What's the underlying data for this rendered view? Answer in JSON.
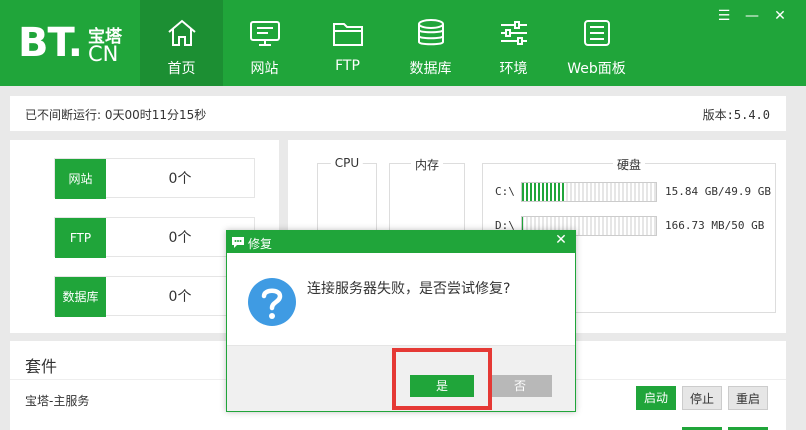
{
  "colors": {
    "brand": "#20a53a",
    "brand_dark": "#1c8f33",
    "highlight": "#e53935",
    "no_button": "#b8b8b8"
  },
  "logo": {
    "main": "BT.",
    "cn_top": "宝塔",
    "cn_bottom": "CN"
  },
  "nav": [
    {
      "label": "首页",
      "icon": "home-icon",
      "active": true
    },
    {
      "label": "网站",
      "icon": "monitor-icon"
    },
    {
      "label": "FTP",
      "icon": "folder-icon"
    },
    {
      "label": "数据库",
      "icon": "database-icon"
    },
    {
      "label": "环境",
      "icon": "sliders-icon"
    },
    {
      "label": "Web面板",
      "icon": "web-panel-icon"
    }
  ],
  "window_controls": {
    "menu": "☰",
    "minimize": "—",
    "close": "✕"
  },
  "status": {
    "uptime": "已不间断运行: 0天00时11分15秒",
    "version": "版本:5.4.0"
  },
  "stats": [
    {
      "key": "网站",
      "value": "0个"
    },
    {
      "key": "FTP",
      "value": "0个"
    },
    {
      "key": "数据库",
      "value": "0个"
    }
  ],
  "monitor": {
    "cpu_title": "CPU",
    "mem_title": "内存",
    "disk_title": "硬盘"
  },
  "disks": [
    {
      "drive": "C:\\",
      "usage": "15.84 GB/49.9 GB",
      "percent": 32
    },
    {
      "drive": "D:\\",
      "usage": "166.73 MB/50 GB",
      "percent": 1
    }
  ],
  "plugins": {
    "title": "套件",
    "service_name": "宝塔-主服务",
    "start": "启动",
    "stop": "停止",
    "restart": "重启"
  },
  "dialog": {
    "title": "修复",
    "close": "✕",
    "message": "连接服务器失败，是否尝试修复?",
    "yes": "是",
    "no": "否"
  }
}
